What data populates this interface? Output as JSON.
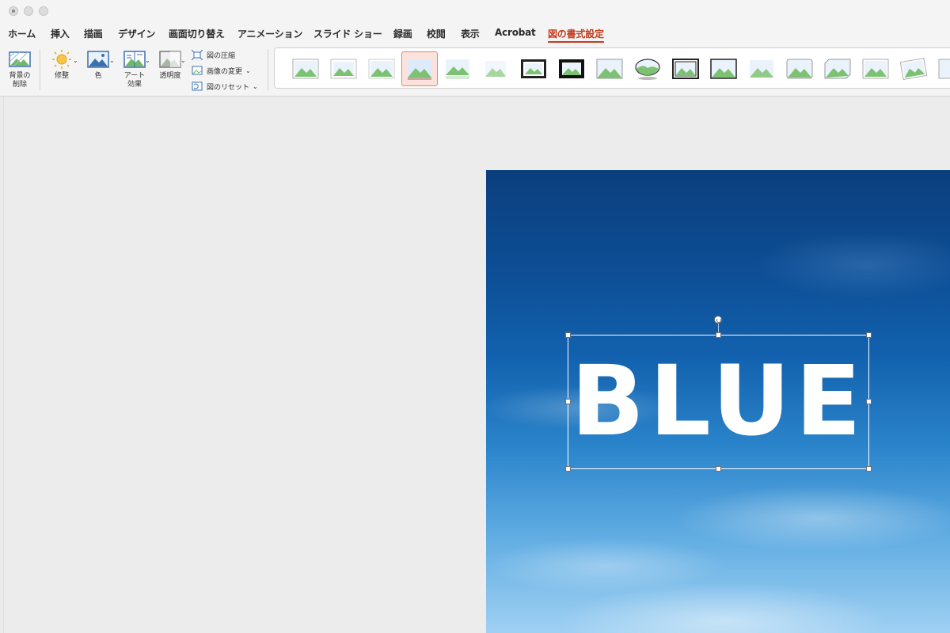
{
  "titlebar": {
    "buttons": [
      "close",
      "minimize",
      "zoom"
    ]
  },
  "tabs": [
    {
      "label": "ホーム"
    },
    {
      "label": "挿入"
    },
    {
      "label": "描画"
    },
    {
      "label": "デザイン"
    },
    {
      "label": "画面切り替え"
    },
    {
      "label": "アニメーション"
    },
    {
      "label": "スライド ショー"
    },
    {
      "label": "録画"
    },
    {
      "label": "校閲"
    },
    {
      "label": "表示"
    },
    {
      "label": "Acrobat"
    },
    {
      "label": "図の書式設定",
      "active": true
    }
  ],
  "ribbon": {
    "remove_bg": {
      "line1": "背景の",
      "line2": "削除",
      "icon": "remove-background-icon"
    },
    "corrections": {
      "label": "修整",
      "icon": "sun-icon"
    },
    "color": {
      "label": "色",
      "icon": "picture-color-icon"
    },
    "artistic": {
      "line1": "アート",
      "line2": "効果",
      "icon": "artistic-effects-icon"
    },
    "transparency": {
      "label": "透明度",
      "icon": "transparency-icon"
    },
    "compress": {
      "label": "図の圧縮",
      "icon": "compress-icon"
    },
    "change": {
      "label": "画像の変更",
      "icon": "change-picture-icon"
    },
    "reset": {
      "label": "図のリセット",
      "icon": "reset-picture-icon"
    },
    "styles_selected_index": 3,
    "styles_count": 18
  },
  "slide": {
    "text": "BLUE",
    "colors": {
      "sky_top": "#0b3f7e",
      "sky_bottom": "#9fd0f2",
      "text": "#ffffff"
    }
  },
  "colors": {
    "accent": "#c43b1d",
    "selected_bg": "#fbe2dc"
  }
}
